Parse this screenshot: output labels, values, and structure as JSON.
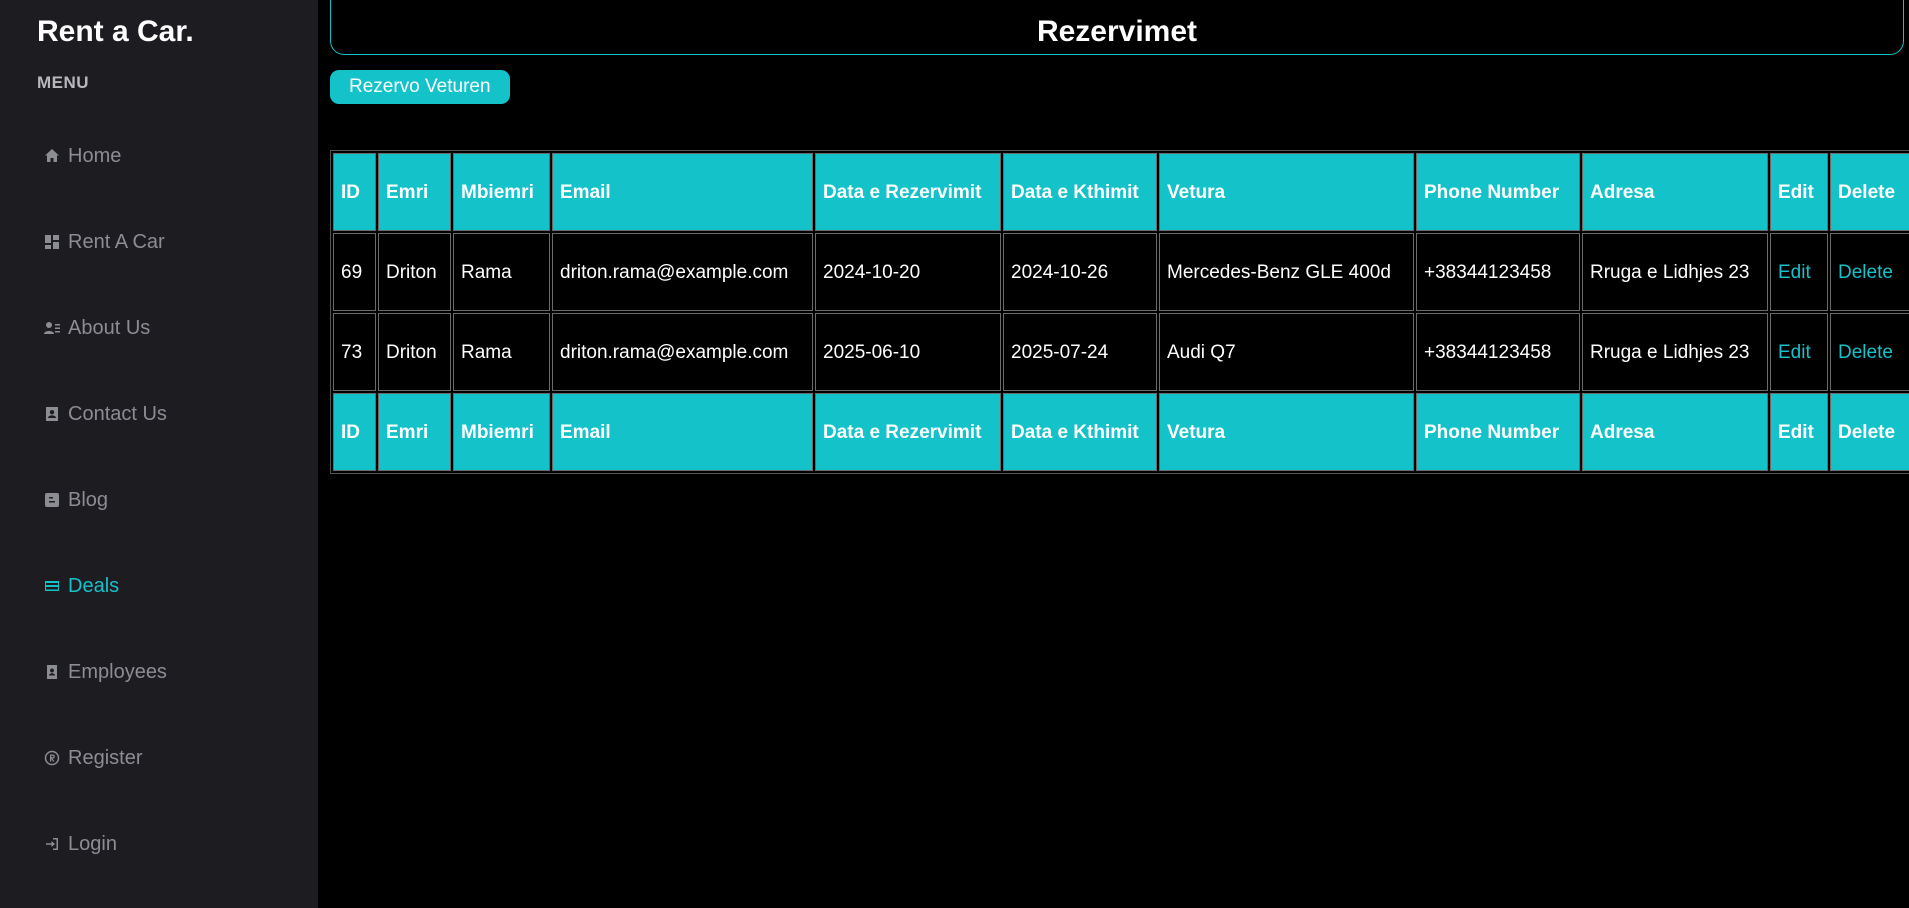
{
  "sidebar": {
    "brand": "Rent a Car.",
    "menu_label": "MENU",
    "items": [
      {
        "label": "Home",
        "icon": "home-icon"
      },
      {
        "label": "Rent A Car",
        "icon": "dashboard-icon"
      },
      {
        "label": "About Us",
        "icon": "user-list-icon"
      },
      {
        "label": "Contact Us",
        "icon": "contact-card-icon"
      },
      {
        "label": "Blog",
        "icon": "blog-icon"
      },
      {
        "label": "Deals",
        "icon": "credit-card-icon",
        "active": true
      },
      {
        "label": "Employees",
        "icon": "id-badge-icon"
      },
      {
        "label": "Register",
        "icon": "registered-icon"
      },
      {
        "label": "Login",
        "icon": "login-icon"
      }
    ]
  },
  "main": {
    "title": "Rezervimet",
    "reserve_button": "Rezervo Veturen",
    "table": {
      "columns": [
        "ID",
        "Emri",
        "Mbiemri",
        "Email",
        "Data e Rezervimit",
        "Data e Kthimit",
        "Vetura",
        "Phone Number",
        "Adresa",
        "Edit",
        "Delete"
      ],
      "rows": [
        {
          "id": "69",
          "emri": "Driton",
          "mbiemri": "Rama",
          "email": "driton.rama@example.com",
          "data_rezervimit": "2024-10-20",
          "data_kthimit": "2024-10-26",
          "vetura": "Mercedes-Benz GLE 400d",
          "phone": "+38344123458",
          "adresa": "Rruga e Lidhjes 23",
          "edit": "Edit",
          "delete": "Delete"
        },
        {
          "id": "73",
          "emri": "Driton",
          "mbiemri": "Rama",
          "email": "driton.rama@example.com",
          "data_rezervimit": "2025-06-10",
          "data_kthimit": "2025-07-24",
          "vetura": "Audi Q7",
          "phone": "+38344123458",
          "adresa": "Rruga e Lidhjes 23",
          "edit": "Edit",
          "delete": "Delete"
        }
      ]
    }
  },
  "colors": {
    "accent": "#14c2ca",
    "sidebar_bg": "#1c1c21",
    "page_bg": "#000000",
    "nav_text": "#8c8c93"
  }
}
